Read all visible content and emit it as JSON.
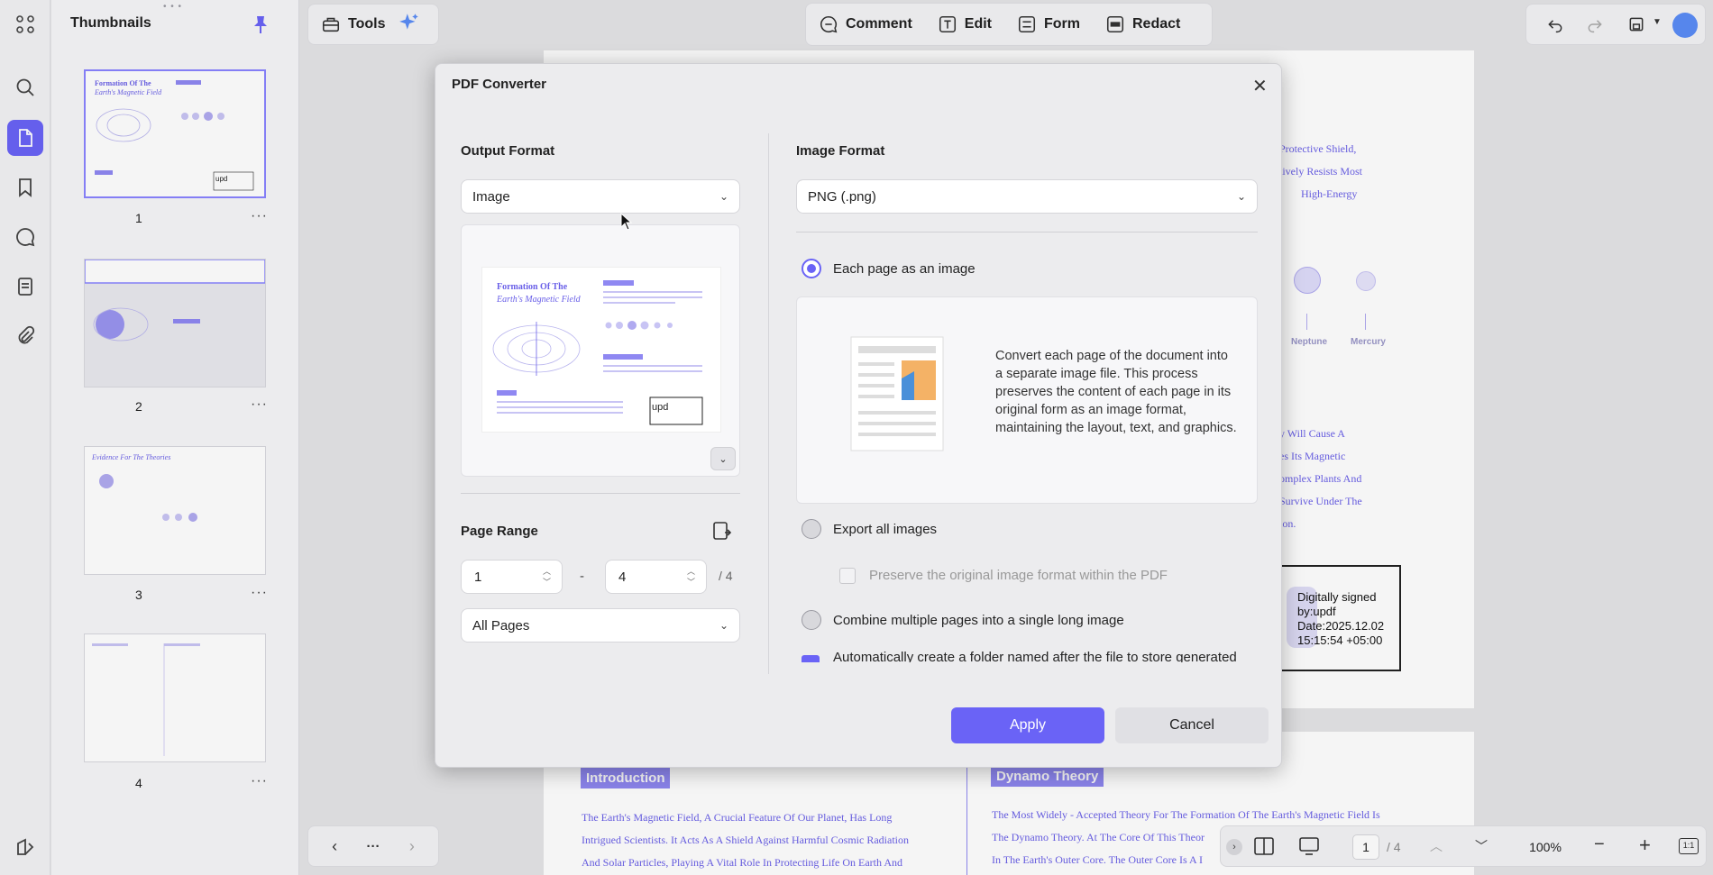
{
  "thumbnails": {
    "title": "Thumbnails",
    "pages": [
      "1",
      "2",
      "3",
      "4"
    ]
  },
  "toolbar_left": {
    "tools": "Tools"
  },
  "toolbar_center": {
    "comment": "Comment",
    "edit": "Edit",
    "form": "Form",
    "redact": "Redact"
  },
  "bottom_nav": {
    "more": "···"
  },
  "page_nav": {
    "current": "1",
    "total": "/ 4",
    "zoom": "100%"
  },
  "document": {
    "right_lines": [
      "Protective Shield,",
      "tively Resists Most",
      "High-Energy",
      "y Will Cause A",
      "es Its Magnetic",
      "omplex Plants And",
      "Survive Under The",
      "ion."
    ],
    "planets": [
      "Neptune",
      "Mercury"
    ],
    "signature": {
      "logo": "upd",
      "text": "Digitally signed by:updf Date:2025.12.02 15:15:54 +05:00"
    },
    "intro_label": "Introduction",
    "intro_text": [
      "The Earth's Magnetic Field, A Crucial Feature Of Our Planet, Has Long",
      "Intrigued Scientists. It Acts As A Shield Against Harmful Cosmic Radiation",
      "And Solar Particles, Playing A Vital Role In Protecting Life On Earth And"
    ],
    "dynamo_label": "Dynamo Theory",
    "dynamo_text": [
      "The Most Widely - Accepted Theory For The Formation Of The Earth's Magnetic Field Is",
      "The Dynamo Theory. At The Core Of This Theor",
      "In The Earth's Outer Core. The Outer Core Is A I"
    ]
  },
  "dialog": {
    "title": "PDF Converter",
    "output_format_label": "Output Format",
    "output_format_value": "Image",
    "preview": {
      "title_line1": "Formation Of The",
      "title_line2": "Earth's Magnetic Field"
    },
    "page_range_label": "Page Range",
    "range_from": "1",
    "range_dash": "-",
    "range_to": "4",
    "range_total": "/ 4",
    "page_scope": "All Pages",
    "image_format_label": "Image Format",
    "image_format_value": "PNG (.png)",
    "options": {
      "each_page": "Each page as an image",
      "each_page_desc": "Convert each page of the document into a separate image file. This process preserves the content of each page in its original form as an image format, maintaining the layout, text, and graphics.",
      "export_all": "Export all images",
      "preserve": "Preserve the original image format within the PDF",
      "combine": "Combine multiple pages into a single long image",
      "auto_folder": "Automatically create a folder named after the file to store generated"
    },
    "apply": "Apply",
    "cancel": "Cancel"
  },
  "colors": {
    "accent": "#6a63f6",
    "doc_text": "#6a60e8"
  }
}
